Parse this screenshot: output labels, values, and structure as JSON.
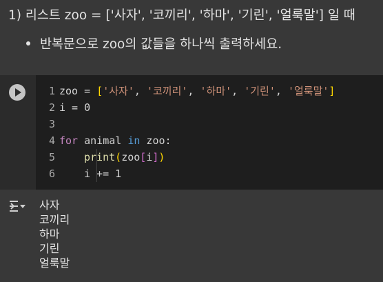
{
  "markdown": {
    "heading": "1) 리스트 zoo = ['사자', '코끼리', '하마', '기린', '얼룩말'] 일 때",
    "bullet": "반복문으로 zoo의 값들을 하나씩 출력하세요."
  },
  "code": {
    "line_numbers": [
      "1",
      "2",
      "3",
      "4",
      "5",
      "6"
    ],
    "line1": {
      "var": "zoo",
      "op": " = ",
      "open": "[",
      "s1": "'사자'",
      "s2": "'코끼리'",
      "s3": "'하마'",
      "s4": "'기린'",
      "s5": "'얼룩말'",
      "sep": ", ",
      "close": "]"
    },
    "line2": "i = 0",
    "line4": {
      "kw_for": "for",
      "mid1": " animal ",
      "kw_in": "in",
      "mid2": " zoo:"
    },
    "line5": {
      "fn": "print",
      "open": "(",
      "mid": "zoo",
      "open2": "[",
      "idx": "i",
      "close2": "]",
      "close": ")"
    },
    "line6": "i += 1"
  },
  "output": {
    "lines": [
      "사자",
      "코끼리",
      "하마",
      "기린",
      "얼룩말"
    ]
  },
  "colors": {
    "background": "#383838",
    "code_background": "#1e1e1e",
    "string": "#ce9178",
    "keyword": "#c586c0",
    "function": "#dcdcaa"
  }
}
